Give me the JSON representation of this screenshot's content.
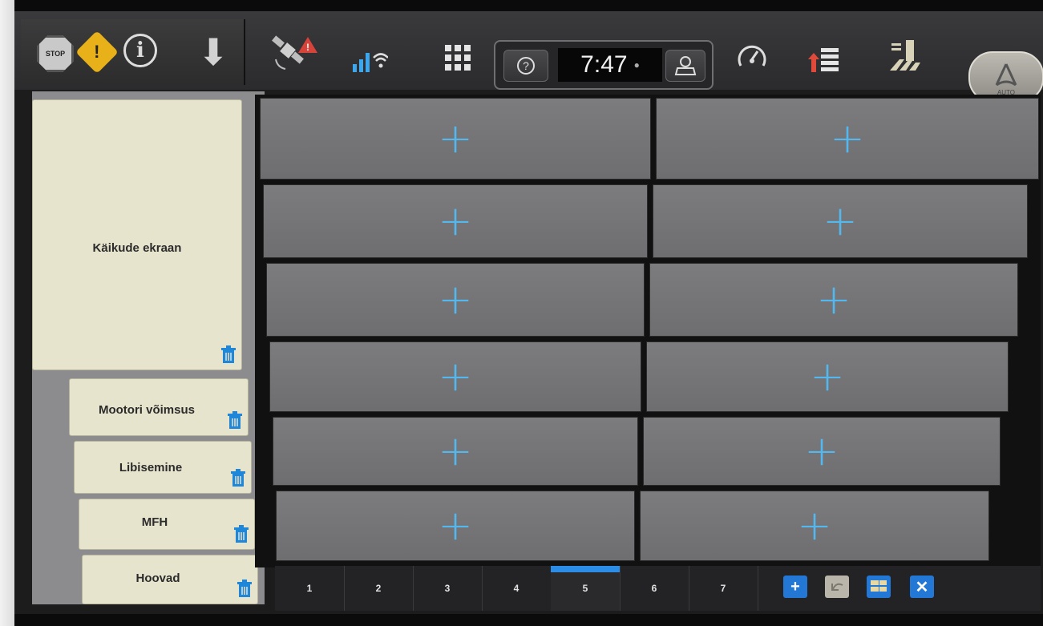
{
  "topbar": {
    "stop_label": "STOP",
    "info_glyph": "i",
    "help_glyph": "?",
    "clock": "7:47",
    "auto_label": "AUTO"
  },
  "sidebar": {
    "items": [
      {
        "label": "Käikude ekraan"
      },
      {
        "label": "Mootori võimsus"
      },
      {
        "label": "Libisemine"
      },
      {
        "label": "MFH"
      },
      {
        "label": "Hoovad"
      }
    ]
  },
  "grid": {
    "cells": [
      "+",
      "+",
      "+",
      "+",
      "+",
      "+",
      "+",
      "+",
      "+",
      "+",
      "+",
      "+"
    ]
  },
  "bottombar": {
    "pages": [
      "1",
      "2",
      "3",
      "4",
      "5",
      "6",
      "7"
    ],
    "active_page": "5",
    "add_label": "+",
    "close_label": "✕"
  },
  "colors": {
    "accent": "#2c8de6",
    "plus": "#52b8ef",
    "warning": "#e8b019",
    "card": "#e7e4cd"
  },
  "icons": [
    "stop-icon",
    "warning-icon",
    "info-icon",
    "down-arrow-icon",
    "satellite-icon",
    "signal-icon",
    "wifi-icon",
    "grid-menu-icon",
    "help-icon",
    "camera-icon",
    "user-icon",
    "speedometer-icon",
    "upload-list-icon",
    "field-icon",
    "auto-steer-icon",
    "trash-icon",
    "plus-icon",
    "undo-icon",
    "layout-icon",
    "close-icon"
  ]
}
